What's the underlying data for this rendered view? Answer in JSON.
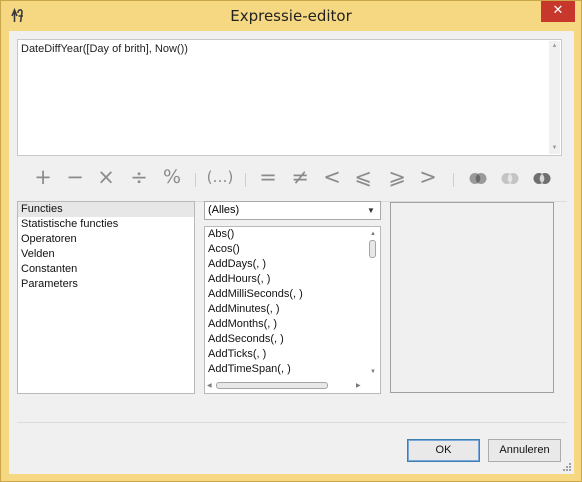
{
  "window": {
    "title": "Expressie-editor",
    "close_glyph": "✕"
  },
  "expression": {
    "text": "DateDiffYear([Day of brith], Now())"
  },
  "operators": {
    "plus": "+",
    "minus": "−",
    "multiply": "×",
    "divide": "÷",
    "percent": "%",
    "parens": "(…)",
    "equals": "=",
    "not_equal": "≠",
    "less": "<",
    "less_equal": "⩽",
    "greater_equal": "⩾",
    "greater": ">"
  },
  "categories": [
    "Functies",
    "Statistische functies",
    "Operatoren",
    "Velden",
    "Constanten",
    "Parameters"
  ],
  "filter": {
    "selected": "(Alles)"
  },
  "functions": [
    "Abs()",
    "Acos()",
    "AddDays(, )",
    "AddHours(, )",
    "AddMilliSeconds(, )",
    "AddMinutes(, )",
    "AddMonths(, )",
    "AddSeconds(, )",
    "AddTicks(, )",
    "AddTimeSpan(, )"
  ],
  "buttons": {
    "ok": "OK",
    "cancel": "Annuleren"
  },
  "icons": {
    "app": "function-icon",
    "close": "close-icon",
    "and": "logical-and-icon",
    "or": "logical-or-icon",
    "not": "logical-not-icon"
  }
}
